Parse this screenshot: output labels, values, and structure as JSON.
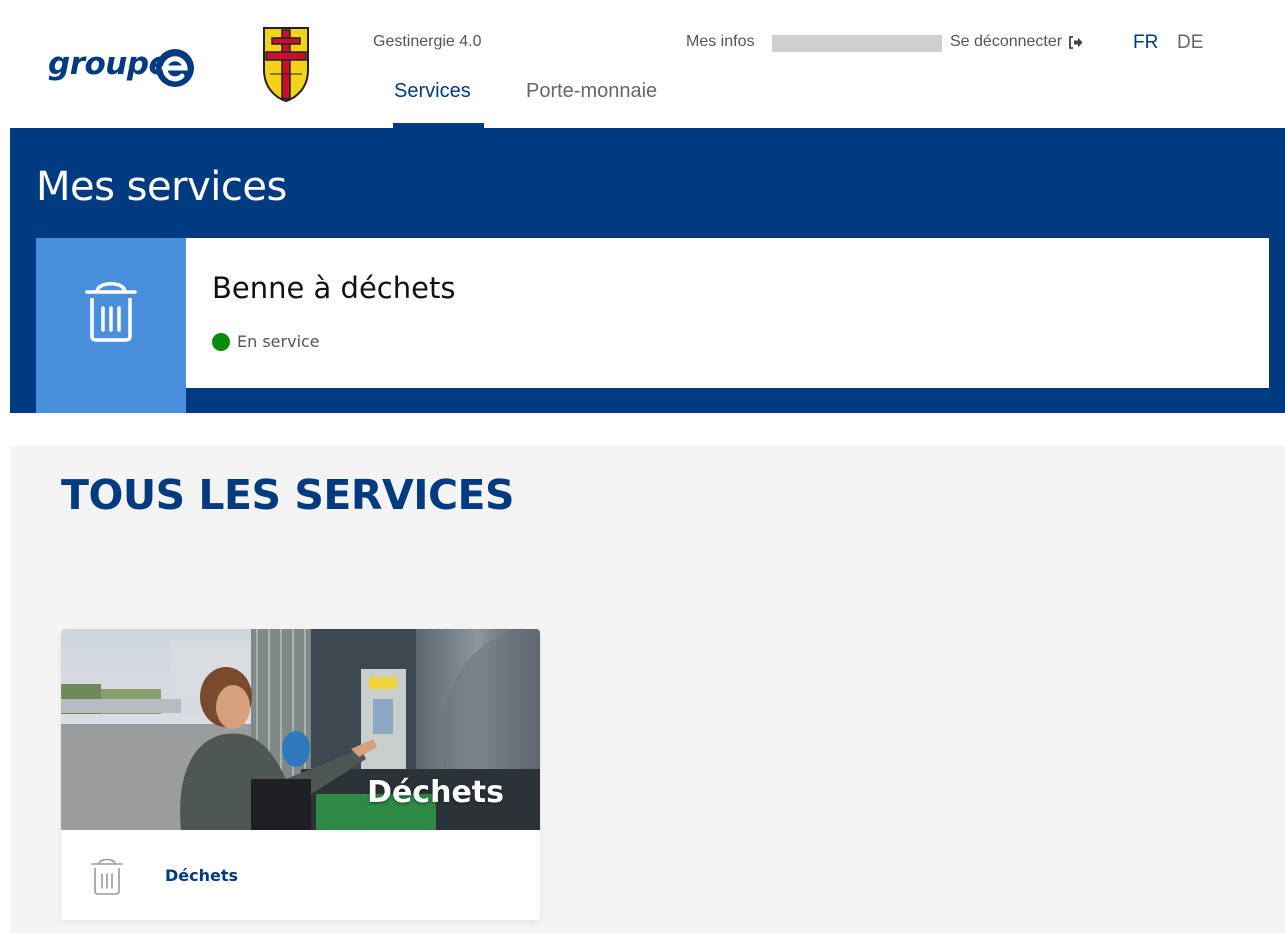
{
  "header": {
    "logo_text": "groupe",
    "app_name": "Gestinergie 4.0",
    "tabs": [
      {
        "label": "Services",
        "active": true
      },
      {
        "label": "Porte-monnaie",
        "active": false
      }
    ],
    "user_menu": {
      "my_info_label": "Mes infos",
      "logout_label": "Se déconnecter",
      "logout_icon": "sign-out-icon"
    },
    "languages": [
      {
        "code": "FR",
        "active": true
      },
      {
        "code": "DE",
        "active": false
      }
    ]
  },
  "my_services": {
    "title": "Mes services",
    "items": [
      {
        "name": "Benne à déchets",
        "icon": "trash-icon",
        "status": "En service",
        "status_color": "#0a8a0a"
      }
    ]
  },
  "all_services": {
    "title": "TOUS LES SERVICES",
    "items": [
      {
        "image_caption": "Déchets",
        "label": "Déchets",
        "icon": "trash-icon"
      }
    ]
  },
  "colors": {
    "brand_navy": "#003a80",
    "service_icon_bg": "#4a8fdc",
    "section_bg": "#f4f4f4"
  }
}
